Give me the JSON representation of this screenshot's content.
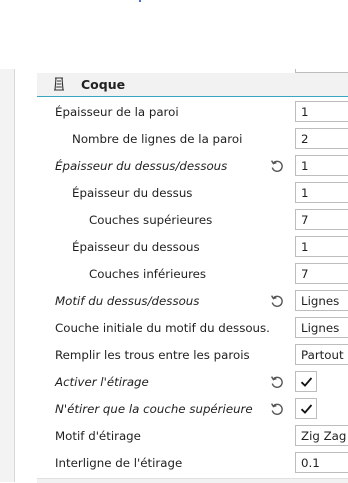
{
  "section": {
    "title": "Coque",
    "icon": "shell-icon"
  },
  "settings": [
    {
      "label": "Épaisseur de la paroi",
      "value": "1",
      "indent": 0,
      "italic": false,
      "reset": false,
      "type": "text"
    },
    {
      "label": "Nombre de lignes de la paroi",
      "value": "2",
      "indent": 1,
      "italic": false,
      "reset": false,
      "type": "text"
    },
    {
      "label": "Épaisseur du dessus/dessous",
      "value": "1",
      "indent": 0,
      "italic": true,
      "reset": true,
      "type": "text"
    },
    {
      "label": "Épaisseur du dessus",
      "value": "1",
      "indent": 1,
      "italic": false,
      "reset": false,
      "type": "text"
    },
    {
      "label": "Couches supérieures",
      "value": "7",
      "indent": 2,
      "italic": false,
      "reset": false,
      "type": "text"
    },
    {
      "label": "Épaisseur du dessous",
      "value": "1",
      "indent": 1,
      "italic": false,
      "reset": false,
      "type": "text"
    },
    {
      "label": "Couches inférieures",
      "value": "7",
      "indent": 2,
      "italic": false,
      "reset": false,
      "type": "text"
    },
    {
      "label": "Motif du dessus/dessous",
      "value": "Lignes",
      "indent": 0,
      "italic": true,
      "reset": true,
      "type": "select"
    },
    {
      "label": "Couche initiale du motif du dessous.",
      "value": "Lignes",
      "indent": 0,
      "italic": false,
      "reset": false,
      "type": "select"
    },
    {
      "label": "Remplir les trous entre les parois",
      "value": "Partout",
      "indent": 0,
      "italic": false,
      "reset": false,
      "type": "select"
    },
    {
      "label": "Activer l'étirage",
      "checked": true,
      "indent": 0,
      "italic": true,
      "reset": true,
      "type": "checkbox"
    },
    {
      "label": "N'étirer que la couche supérieure",
      "checked": true,
      "indent": 0,
      "italic": true,
      "reset": true,
      "type": "checkbox"
    },
    {
      "label": "Motif d'étirage",
      "value": "Zig Zag",
      "indent": 0,
      "italic": false,
      "reset": false,
      "type": "select"
    },
    {
      "label": "Interligne de l'étirage",
      "value": "0.1",
      "indent": 0,
      "italic": false,
      "reset": false,
      "type": "text"
    }
  ],
  "colors": {
    "accent": "#3aa6bf",
    "header_bg": "#f2f2f2",
    "border": "#bdbdbd"
  },
  "icons": {
    "reset": "reset-icon",
    "check": "check-icon"
  }
}
